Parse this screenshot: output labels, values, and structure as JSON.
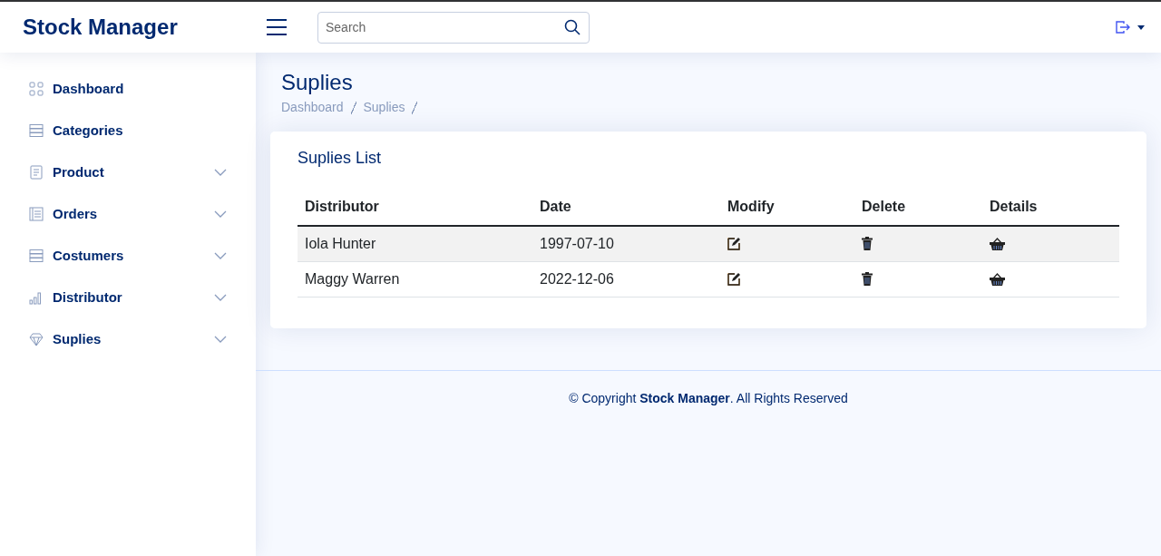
{
  "header": {
    "brand": "Stock Manager",
    "search": {
      "placeholder": "Search"
    }
  },
  "sidebar": {
    "items": [
      {
        "label": "Dashboard",
        "kind": "grid",
        "has_submenu": false
      },
      {
        "label": "Categories",
        "kind": "stack",
        "has_submenu": false
      },
      {
        "label": "Product",
        "kind": "doc",
        "has_submenu": true
      },
      {
        "label": "Orders",
        "kind": "list",
        "has_submenu": true
      },
      {
        "label": "Costumers",
        "kind": "stack",
        "has_submenu": true
      },
      {
        "label": "Distributor",
        "kind": "bars",
        "has_submenu": true
      },
      {
        "label": "Suplies",
        "kind": "gem",
        "has_submenu": true
      }
    ]
  },
  "page": {
    "title": "Suplies",
    "breadcrumb": [
      "Dashboard",
      "Suplies"
    ]
  },
  "card": {
    "title": "Suplies List",
    "table": {
      "columns": [
        "Distributor",
        "Date",
        "Modify",
        "Delete",
        "Details"
      ],
      "rows": [
        {
          "distributor": "Iola Hunter",
          "date": "1997-07-10"
        },
        {
          "distributor": "Maggy Warren",
          "date": "2022-12-06"
        }
      ]
    }
  },
  "footer": {
    "text": "© Copyright **Stock Manager**. All Rights Reserved"
  }
}
